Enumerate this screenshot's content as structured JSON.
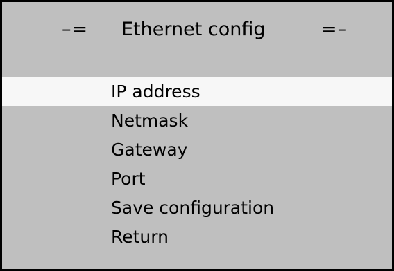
{
  "screen": {
    "title": {
      "left_decoration": "–=",
      "text": "Ethernet config",
      "right_decoration": "=–"
    },
    "menu": {
      "selected_index": 0,
      "items": [
        {
          "label": "IP address"
        },
        {
          "label": "Netmask"
        },
        {
          "label": "Gateway"
        },
        {
          "label": "Port"
        },
        {
          "label": "Save configuration"
        },
        {
          "label": "Return"
        }
      ]
    }
  },
  "colors": {
    "screen_background": "#bfbfbf",
    "selected_background": "#f7f7f7",
    "text": "#000000",
    "frame": "#000000"
  }
}
